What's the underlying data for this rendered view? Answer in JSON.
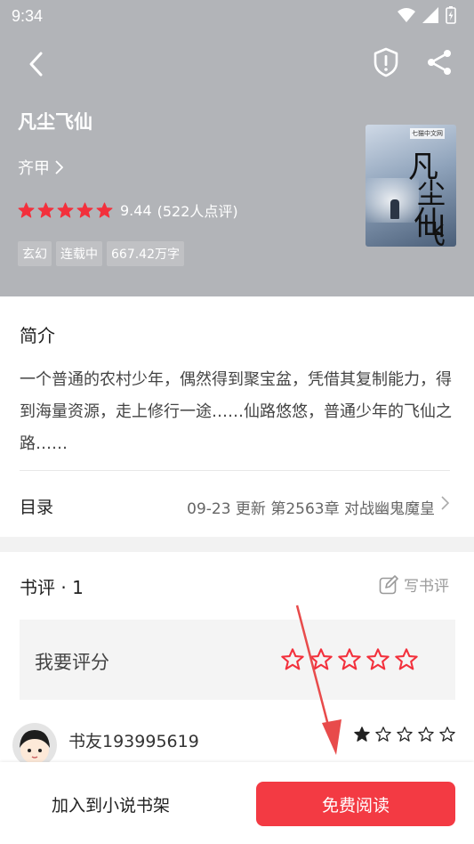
{
  "status_bar": {
    "time": "9:34"
  },
  "book": {
    "title": "凡尘飞仙",
    "author": "齐甲",
    "score": "9.44",
    "review_count_text": "(522人点评)",
    "rating_stars": 5,
    "tags": [
      "玄幻",
      "连载中",
      "667.42万字"
    ],
    "cover": {
      "badge": "七猫中文网",
      "title_chars": [
        "凡",
        "尘飞",
        "仙"
      ]
    }
  },
  "intro": {
    "title": "简介",
    "text": "一个普通的农村少年，偶然得到聚宝盆，凭借其复制能力，得到海量资源，走上修行一途……仙路悠悠，普通少年的飞仙之路……"
  },
  "toc": {
    "label": "目录",
    "update": "09-23  更新  第2563章 对战幽鬼魔皇"
  },
  "reviews": {
    "title": "书评 · 1",
    "write_label": "写书评",
    "rate_label": "我要评分",
    "items": [
      {
        "user": "书友193995619",
        "stars": 1
      }
    ]
  },
  "bottom_bar": {
    "add_shelf": "加入到小说书架",
    "read": "免费阅读"
  },
  "colors": {
    "accent": "#f33a43",
    "header_bg": "#b2b4b8",
    "star_red": "#f3303c"
  }
}
